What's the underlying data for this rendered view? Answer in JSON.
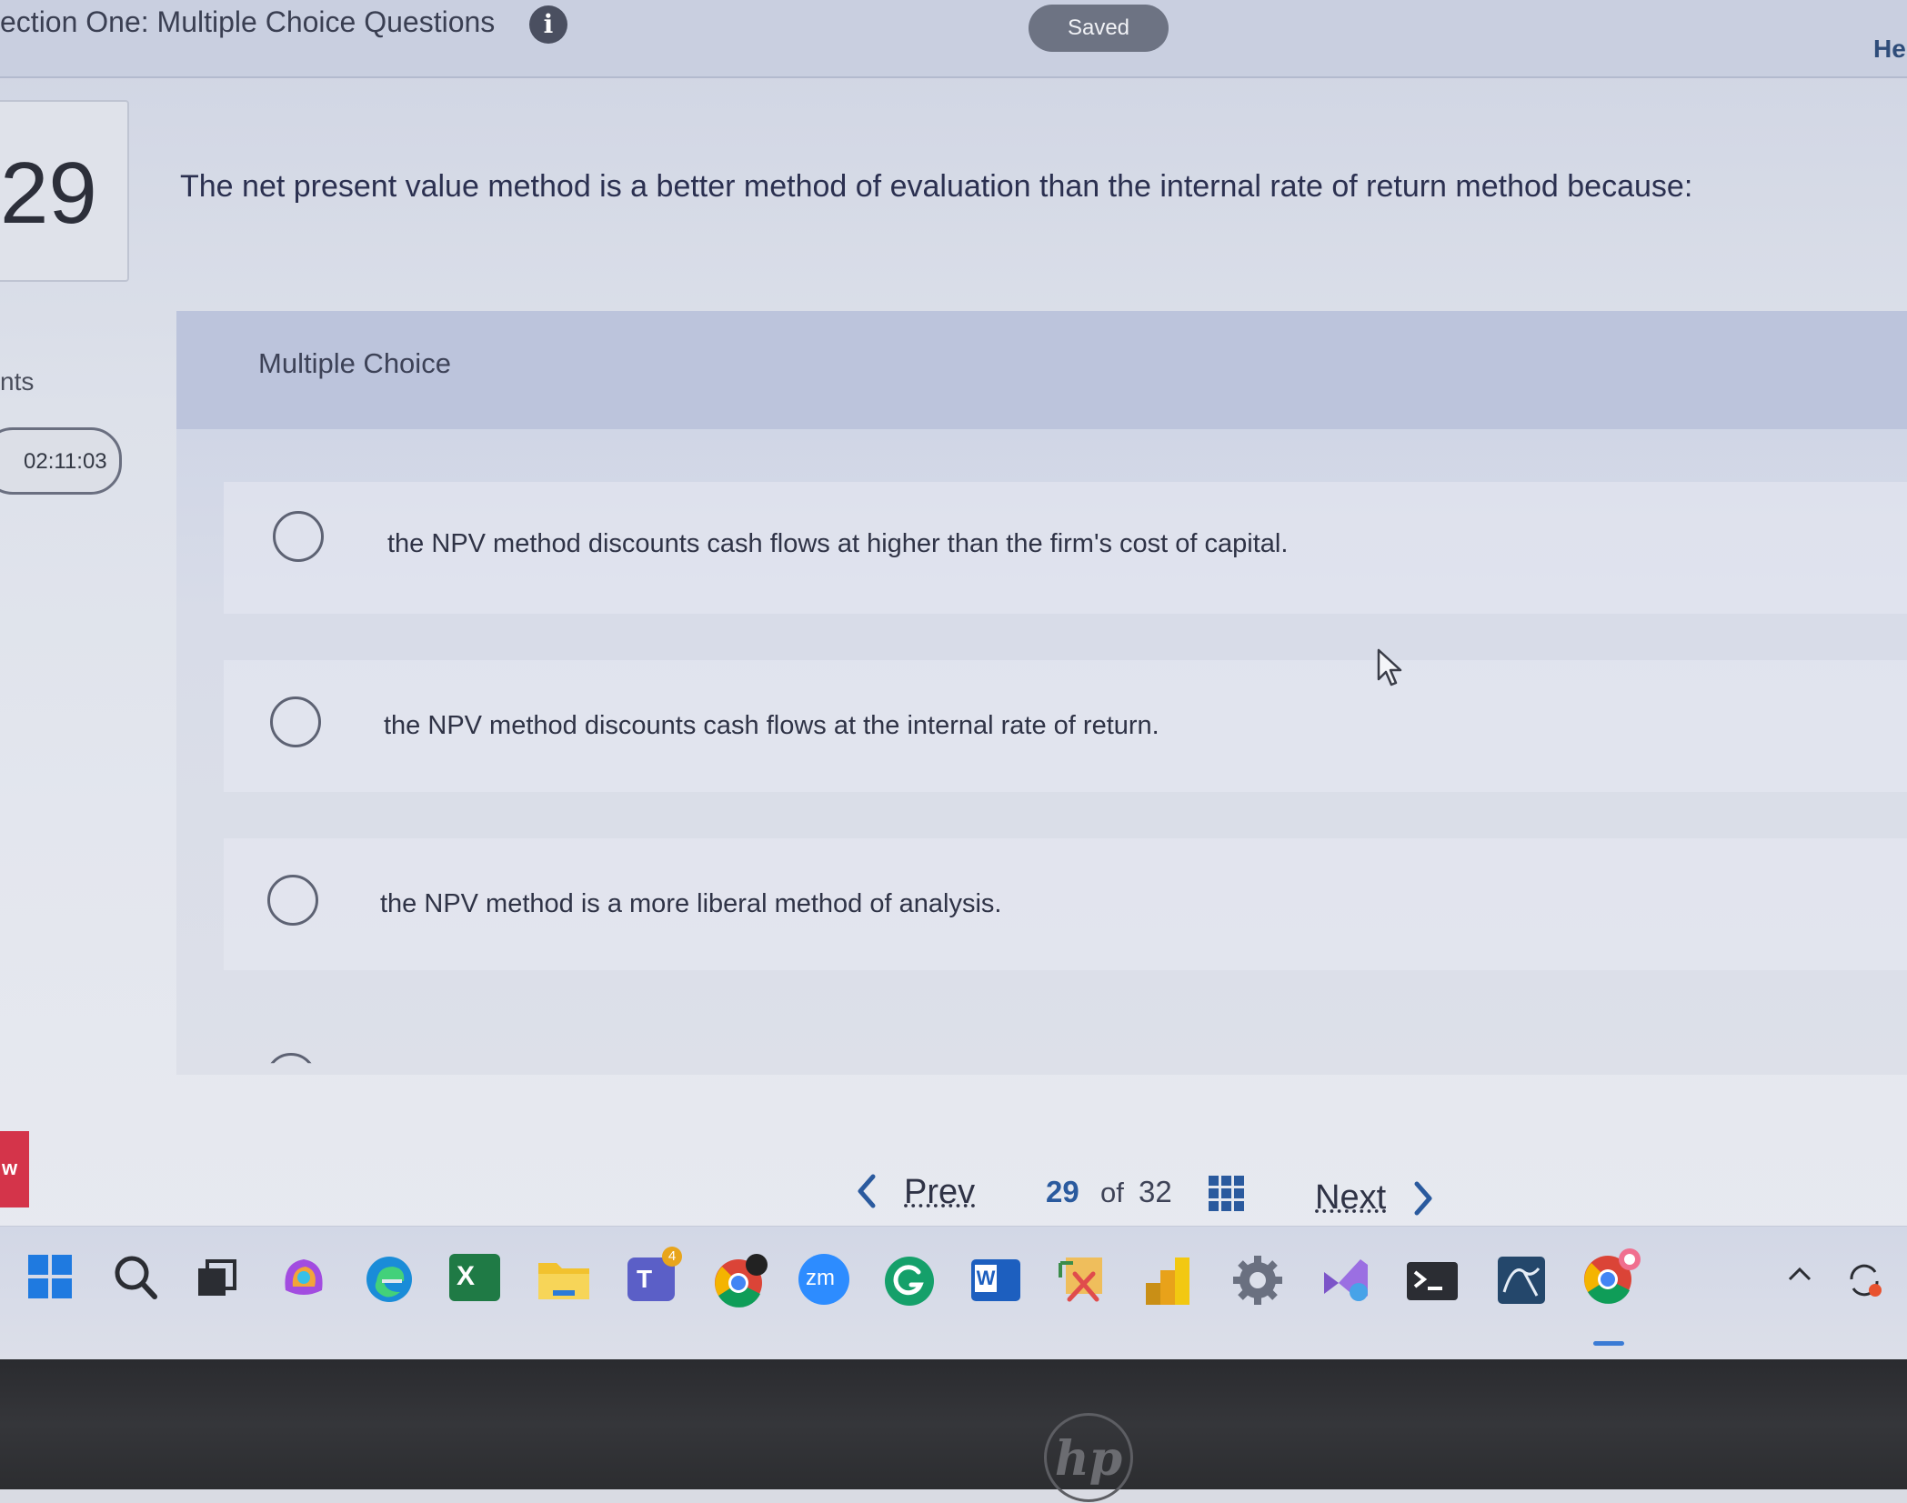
{
  "header": {
    "section_title": "ection One: Multiple Choice Questions",
    "info_glyph": "i",
    "saved_status": "Saved",
    "help_label": "He"
  },
  "question": {
    "number": "29",
    "text": "The net present value method is a better method of evaluation than the internal rate of return method because:",
    "points_label": "nts",
    "timer": "02:11:03"
  },
  "choices_panel": {
    "label": "Multiple Choice",
    "options": [
      {
        "text": "the NPV method discounts cash flows at higher than the firm's cost of capital.",
        "selected": false
      },
      {
        "text": "the NPV method discounts cash flows at the internal rate of return.",
        "selected": false
      },
      {
        "text": "the NPV method is a more liberal method of analysis.",
        "selected": false
      }
    ]
  },
  "navigation": {
    "prev_label": "Prev",
    "current_page": "29",
    "of_label": "of",
    "total_pages": "32",
    "next_label": "Next"
  },
  "side_tab": {
    "label": "w"
  },
  "taskbar": {
    "apps": [
      "windows-start-icon",
      "search-icon",
      "task-view-icon",
      "copilot-icon",
      "edge-icon",
      "excel-icon",
      "file-explorer-icon",
      "teams-icon",
      "chrome-icon",
      "zoom-icon",
      "grammarly-icon",
      "word-icon",
      "snipping-tool-icon",
      "power-bi-icon",
      "settings-icon",
      "visual-studio-icon",
      "terminal-icon",
      "mysql-workbench-icon",
      "chrome-profile-icon"
    ],
    "zoom_label": "zm",
    "word_label": "W",
    "excel_label": "X",
    "teams_label": "T",
    "teams_badge": "4"
  },
  "brand": {
    "logo_text": "hp"
  },
  "colors": {
    "accent": "#2a5a9e",
    "saved_pill": "#6d7383",
    "side_tab": "#d4344a"
  }
}
